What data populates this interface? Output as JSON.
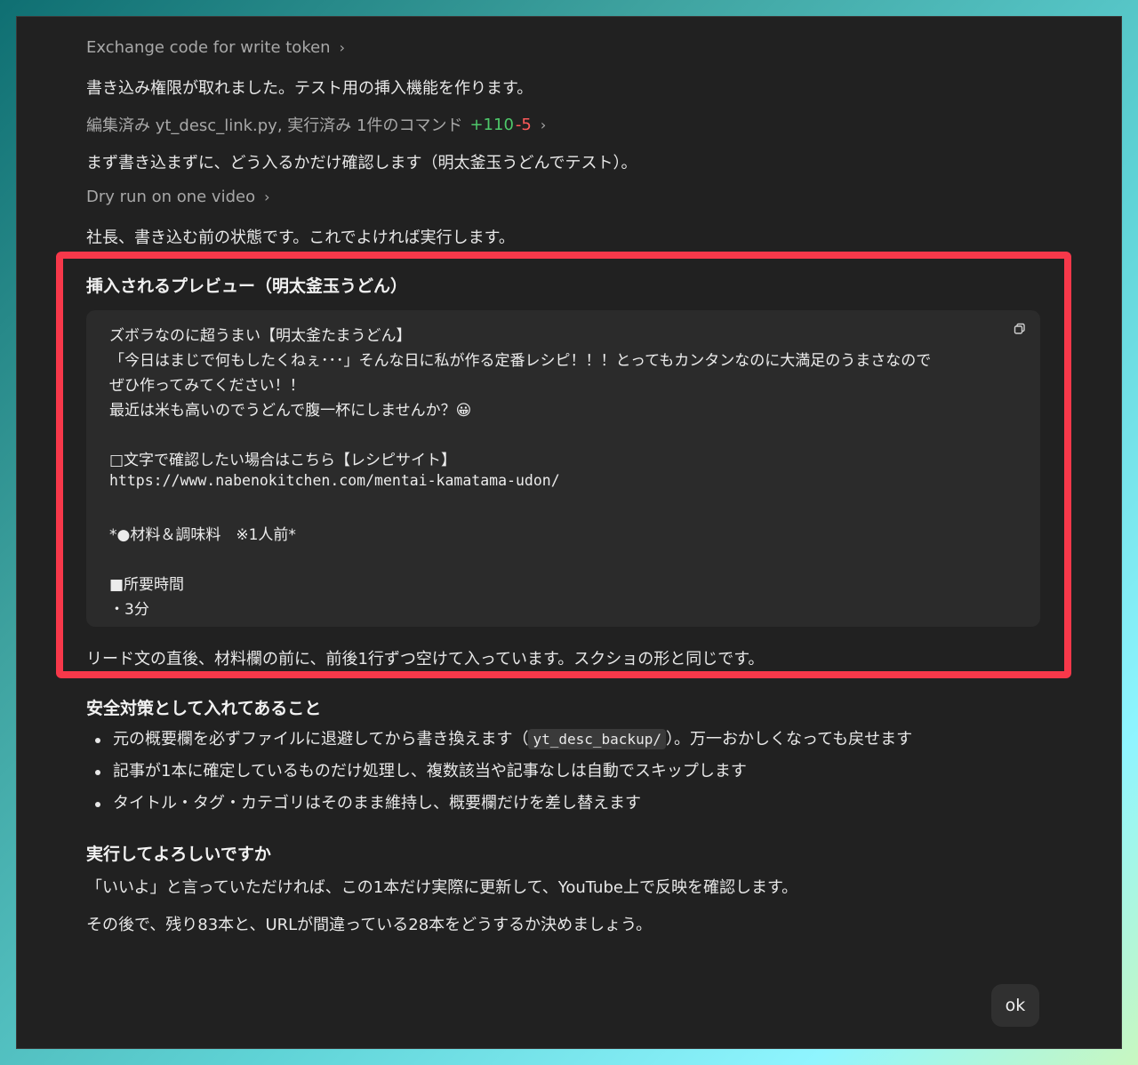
{
  "steps": {
    "exchange_label": "Exchange code for write token",
    "edited_label": "編集済み yt_desc_link.py, 実行済み 1件のコマンド",
    "edited_plus": "+110",
    "edited_minus": "-5",
    "dry_run_label": "Dry run on one video"
  },
  "messages": {
    "p1": "書き込み権限が取れました。テスト用の挿入機能を作ります。",
    "p2": "まず書き込まずに、どう入るかだけ確認します（明太釜玉うどんでテスト）。",
    "p3": "社長、書き込む前の状態です。これでよければ実行します。"
  },
  "preview": {
    "title": "挿入されるプレビュー（明太釜玉うどん）",
    "lines": [
      "ズボラなのに超うまい【明太釜たまうどん】",
      "「今日はまじで何もしたくねぇ･･･」そんな日に私が作る定番レシピ！！！とってもカンタンなのに大満足のうまさなので",
      "ぜひ作ってみてください！！",
      "最近は米も高いのでうどんで腹一杯にしませんか？😀",
      "□文字で確認したい場合はこちら【レシピサイト】",
      "https://www.nabenokitchen.com/mentai-kamatama-udon/",
      "*●材料＆調味料　※1人前*",
      "■所要時間",
      "・3分"
    ],
    "note": "リード文の直後、材料欄の前に、前後1行ずつ空けて入っています。スクショの形と同じです。"
  },
  "safety": {
    "heading": "安全対策として入れてあること",
    "b1_pre": "元の概要欄を必ずファイルに退避してから書き換えます（",
    "b1_code": "yt_desc_backup/",
    "b1_post": "）。万一おかしくなっても戻せます",
    "b2": "記事が1本に確定しているものだけ処理し、複数該当や記事なしは自動でスキップします",
    "b3": "タイトル・タグ・カテゴリはそのまま維持し、概要欄だけを差し替えます"
  },
  "confirm": {
    "heading": "実行してよろしいですか",
    "p1": "「いいよ」と言っていただければ、この1本だけ実際に更新して、YouTube上で反映を確認します。",
    "p2": "その後で、残り83本と、URLが間違っている28本をどうするか決めましょう。"
  },
  "ok_button": "ok",
  "colors": {
    "highlight_border": "#f7384a",
    "diff_plus": "#4ec86a",
    "diff_minus": "#ff5a5a"
  }
}
